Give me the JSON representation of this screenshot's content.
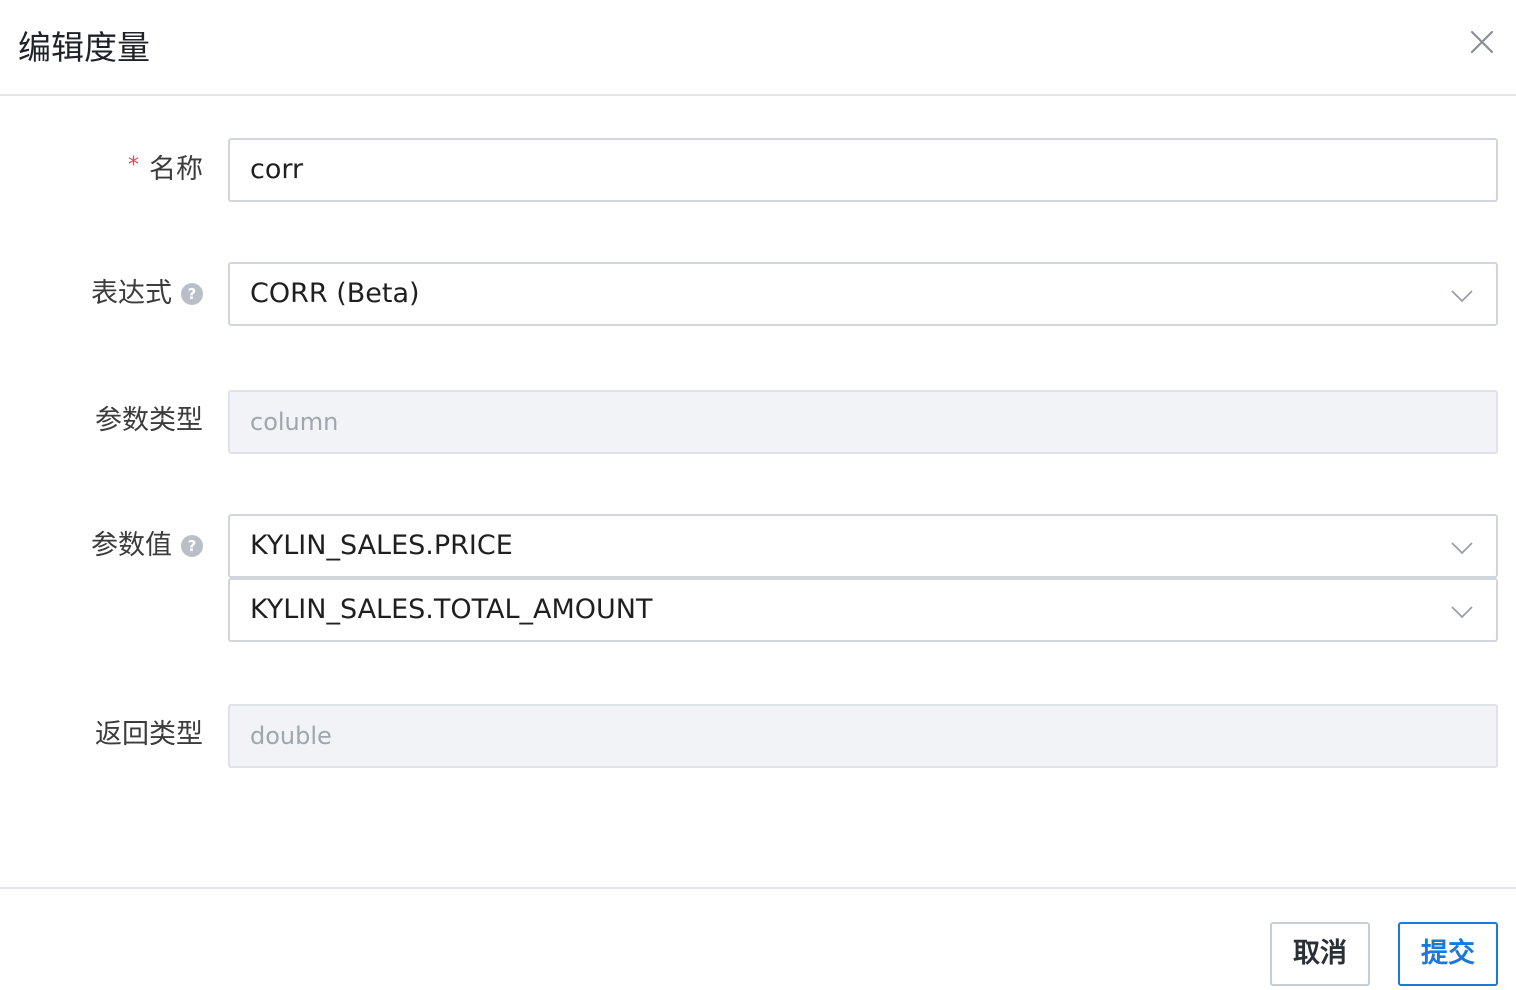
{
  "dialog": {
    "title": "编辑度量",
    "close_icon": "close-icon"
  },
  "form": {
    "name": {
      "required_mark": "*",
      "label": "名称",
      "value": "corr"
    },
    "expression": {
      "label": "表达式",
      "help_icon": "question-icon",
      "help_glyph": "?",
      "value": "CORR (Beta)",
      "dropdown_icon": "chevron-down-icon"
    },
    "param_type": {
      "label": "参数类型",
      "value": "column"
    },
    "param_value": {
      "label": "参数值",
      "help_icon": "question-icon",
      "help_glyph": "?",
      "values": [
        "KYLIN_SALES.PRICE",
        "KYLIN_SALES.TOTAL_AMOUNT"
      ],
      "dropdown_icon": "chevron-down-icon"
    },
    "return_type": {
      "label": "返回类型",
      "value": "double"
    }
  },
  "footer": {
    "cancel_label": "取消",
    "submit_label": "提交"
  },
  "colors": {
    "required": "#e5484d",
    "primary": "#1d78d6",
    "border": "#d2d6dc",
    "disabled_bg": "#f1f3f6"
  }
}
